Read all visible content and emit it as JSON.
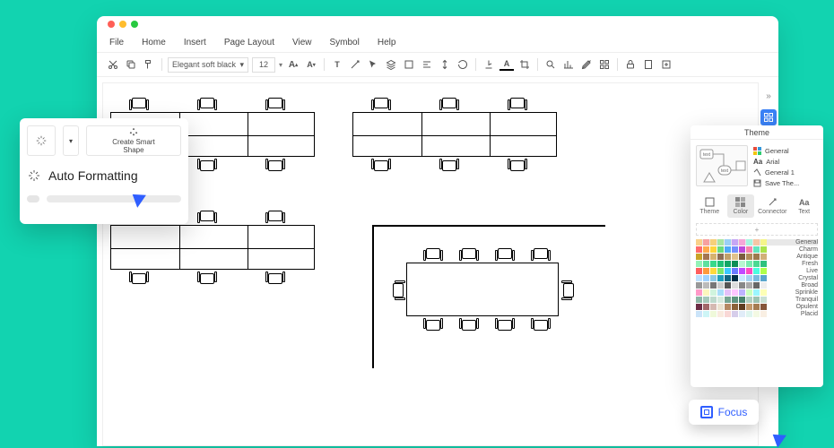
{
  "menu": {
    "items": [
      "File",
      "Home",
      "Insert",
      "Page Layout",
      "View",
      "Symbol",
      "Help"
    ]
  },
  "toolbar": {
    "font": "Elegant soft black",
    "size": "12"
  },
  "popover": {
    "create_label": "Create Smart\nShape",
    "title": "Auto Formatting"
  },
  "theme": {
    "title": "Theme",
    "opts": [
      "General",
      "Arial",
      "General 1",
      "Save The..."
    ],
    "tabs": [
      "Theme",
      "Color",
      "Connector",
      "Text"
    ],
    "active_tab": 1,
    "swatch_rows": [
      {
        "name": "General",
        "sel": true,
        "c": [
          "#f9d18a",
          "#f7a0a0",
          "#f6d07a",
          "#a8e6a3",
          "#9ad0f5",
          "#c6a6f5",
          "#f5a6d7",
          "#a6f5e0",
          "#f5c6a6",
          "#f5f58a"
        ]
      },
      {
        "name": "Charm",
        "c": [
          "#ff6b6b",
          "#ffa94d",
          "#ffd43b",
          "#69db7c",
          "#4dabf7",
          "#748ffc",
          "#be4bdb",
          "#f783ac",
          "#63e6be",
          "#a9e34b"
        ]
      },
      {
        "name": "Antique",
        "c": [
          "#c9a227",
          "#a47551",
          "#d6b370",
          "#8c6e54",
          "#bfa06b",
          "#e0c28c",
          "#7a5c3e",
          "#b08c5a",
          "#9c7a4f",
          "#d1b079"
        ]
      },
      {
        "name": "Fresh",
        "c": [
          "#94f2b8",
          "#5ee0a0",
          "#38d98a",
          "#1fc177",
          "#12a765",
          "#0e8e55",
          "#b8f5d0",
          "#7aebb0",
          "#4bd993",
          "#2dc27e"
        ]
      },
      {
        "name": "Live",
        "c": [
          "#ff5e5e",
          "#ff9a3c",
          "#ffd93c",
          "#7be86b",
          "#3cc9ff",
          "#6b7bff",
          "#c14bff",
          "#ff4bc1",
          "#4bffe0",
          "#b0ff4b"
        ]
      },
      {
        "name": "Crystal",
        "c": [
          "#bde0fe",
          "#a2d2ff",
          "#8ecae6",
          "#219ebc",
          "#126782",
          "#023047",
          "#cae9ff",
          "#a7d3f2",
          "#7cbde0",
          "#5aa6cc"
        ]
      },
      {
        "name": "Broad",
        "c": [
          "#999",
          "#bbb",
          "#777",
          "#ccc",
          "#555",
          "#ddd",
          "#888",
          "#aaa",
          "#666",
          "#eee"
        ]
      },
      {
        "name": "Sprinkle",
        "c": [
          "#ff99c8",
          "#fcf6bd",
          "#d0f4de",
          "#a9def9",
          "#e4c1f9",
          "#ffc6ff",
          "#bdb2ff",
          "#caffbf",
          "#9bf6ff",
          "#fdffb6"
        ]
      },
      {
        "name": "Tranquil",
        "c": [
          "#8eb8a7",
          "#a6c9ba",
          "#bedacd",
          "#d6ebdf",
          "#76a693",
          "#5f9480",
          "#48826d",
          "#b0d1c3",
          "#9cc4b3",
          "#c8e0d4"
        ]
      },
      {
        "name": "Opulent",
        "c": [
          "#6d2e46",
          "#a26769",
          "#d5b9b2",
          "#ece2d0",
          "#b58863",
          "#8c6239",
          "#5e3c20",
          "#c49a6c",
          "#a67c52",
          "#86563a"
        ]
      },
      {
        "name": "Placid",
        "c": [
          "#cbe4f9",
          "#cdf5f6",
          "#eff9da",
          "#f9ebdf",
          "#f9d8d6",
          "#d6cdea",
          "#e0ecf8",
          "#def5ef",
          "#f3f9e3",
          "#f9efe3"
        ]
      }
    ]
  },
  "focus": {
    "label": "Focus"
  },
  "preview": {
    "text_a": "text",
    "text_b": "text"
  }
}
